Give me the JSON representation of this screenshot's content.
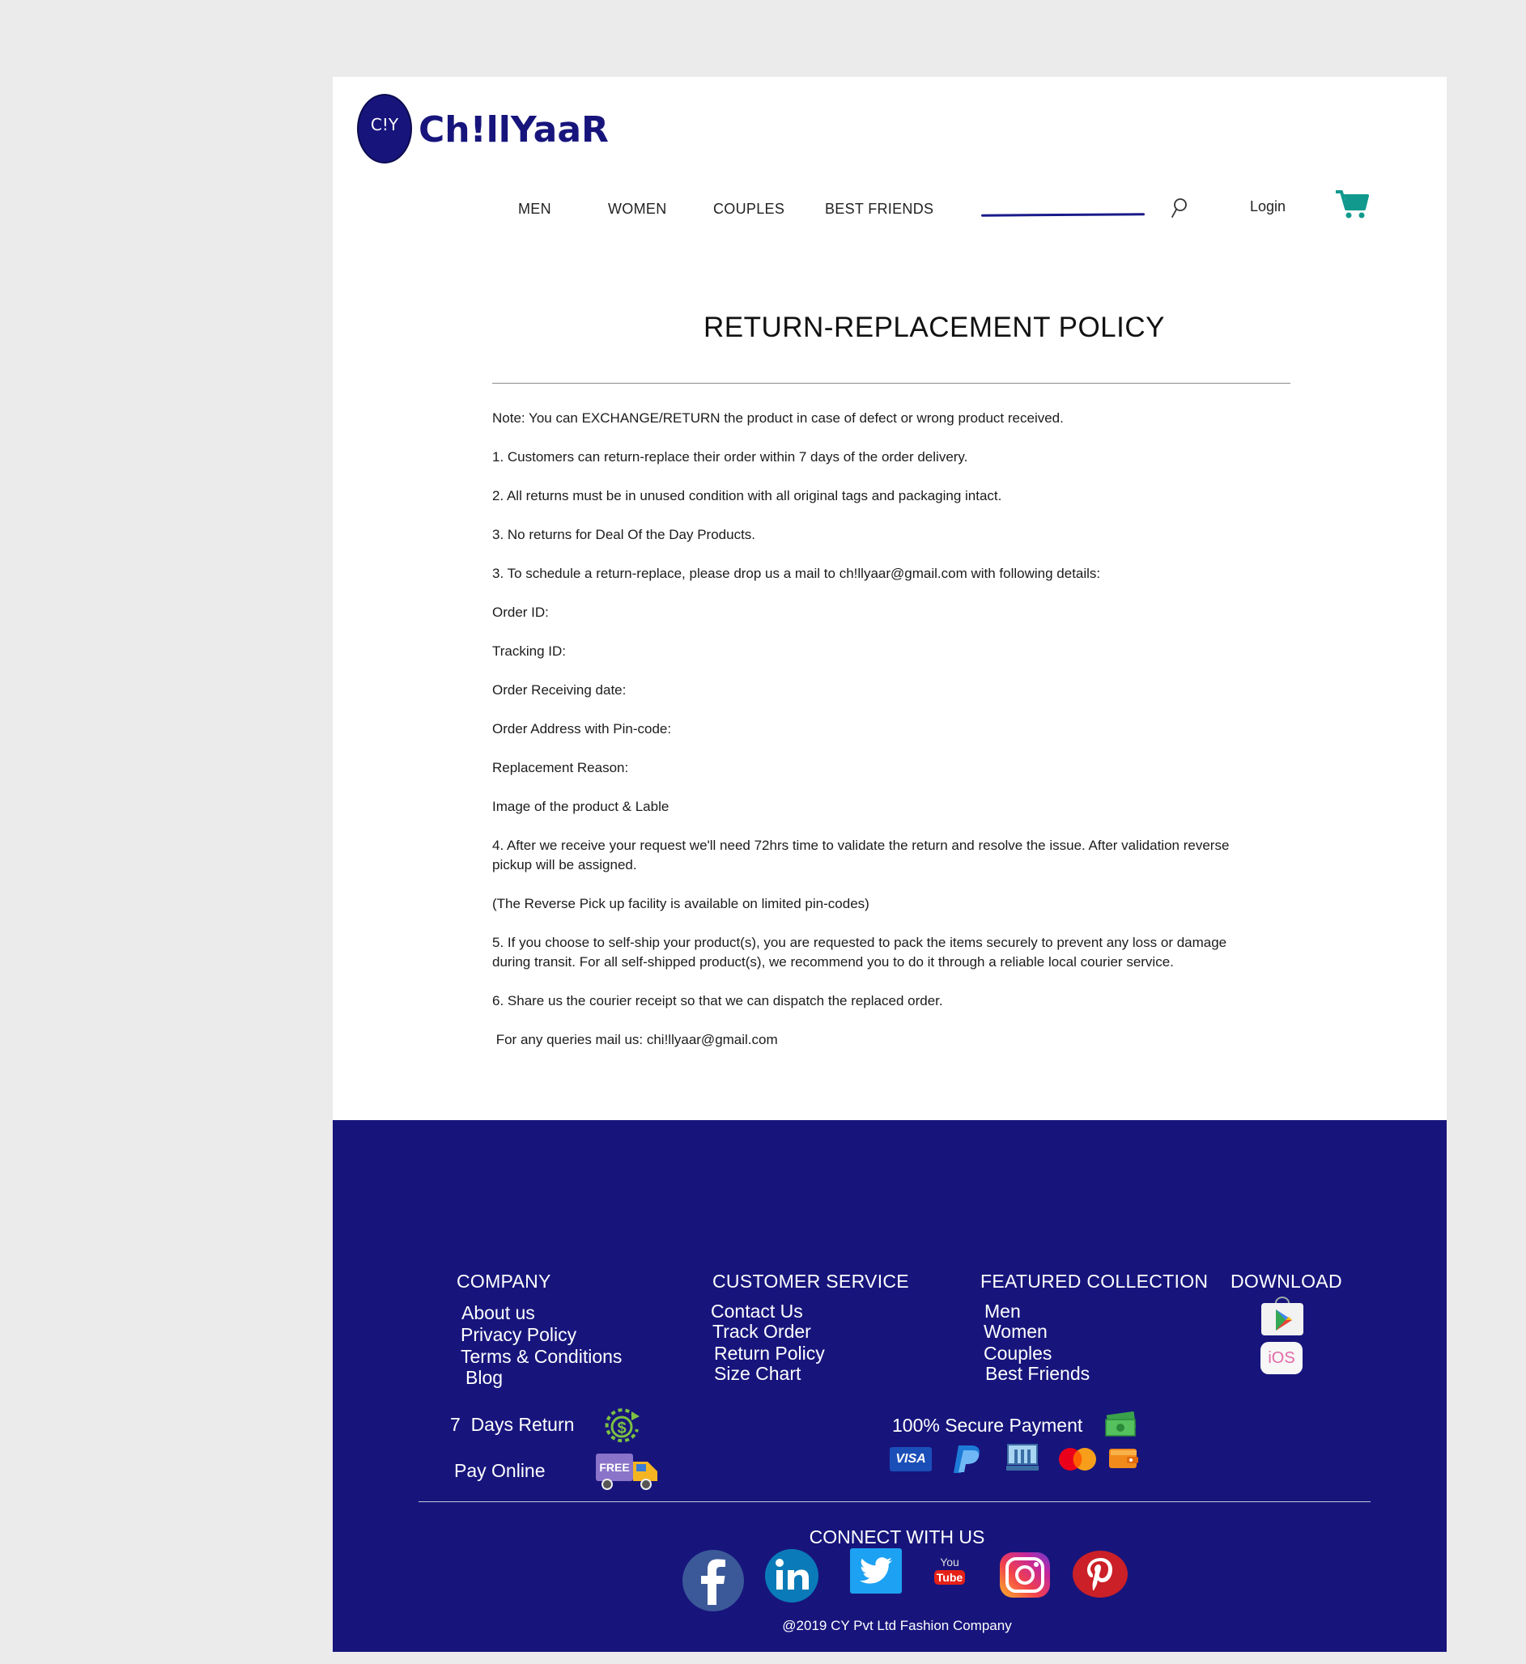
{
  "header": {
    "logo_initials": "C!Y",
    "brand_name": "Ch!llYaaR",
    "nav": [
      "MEN",
      "WOMEN",
      "COUPLES",
      "BEST FRIENDS"
    ],
    "login_label": "Login"
  },
  "content": {
    "title": "RETURN-REPLACEMENT POLICY",
    "paragraphs": [
      "Note: You can EXCHANGE/RETURN the product in case of defect or wrong product received.",
      "1. Customers can return-replace their order within 7 days of the order delivery.",
      "2. All returns must be in unused condition with all original tags and packaging intact.",
      "3. No returns for Deal Of the Day  Products.",
      "3. To schedule a return-replace, please drop us a mail to ch!llyaar@gmail.com with following details:",
      "Order ID:",
      "Tracking ID:",
      "Order Receiving date:",
      "Order Address with Pin-code:",
      "Replacement Reason:",
      "Image of the product & Lable",
      "4. After we receive your request we'll need 72hrs time to validate the return and resolve the issue. After validation reverse pickup will be assigned.",
      "(The Reverse Pick up facility is available on limited pin-codes)",
      "5. If you choose to self-ship your product(s), you are requested to pack the items securely to prevent any loss or damage during transit. For all self-shipped product(s), we recommend you to do it through a reliable local courier service.",
      "6. Share us the courier receipt so that we can dispatch the replaced order.",
      " For any queries mail us: chi!llyaar@gmail.com"
    ]
  },
  "footer": {
    "company": {
      "heading": "COMPANY",
      "links": [
        "About us",
        "Privacy Policy",
        "Terms & Conditions",
        "Blog"
      ]
    },
    "customer_service": {
      "heading": "CUSTOMER SERVICE",
      "links": [
        "Contact Us",
        "Track Order",
        "Return Policy",
        "Size Chart"
      ]
    },
    "featured": {
      "heading": "FEATURED COLLECTION",
      "links": [
        "Men",
        "Women",
        "Couples",
        "Best Friends"
      ]
    },
    "download": {
      "heading": "DOWNLOAD",
      "ios_label": "iOS"
    },
    "badges": {
      "days_return": "7  Days Return",
      "pay_online": "Pay Online",
      "free_label": "FREE",
      "secure_payment": "100% Secure Payment",
      "visa_label": "VISA"
    },
    "connect_heading": "CONNECT WITH US",
    "youtube_you": "You",
    "youtube_tube": "Tube",
    "copyright": "@2019 CY Pvt Ltd Fashion Company"
  },
  "colors": {
    "brand_navy": "#17157c",
    "cart_teal": "#12998e",
    "page_bg": "#ebebeb"
  }
}
